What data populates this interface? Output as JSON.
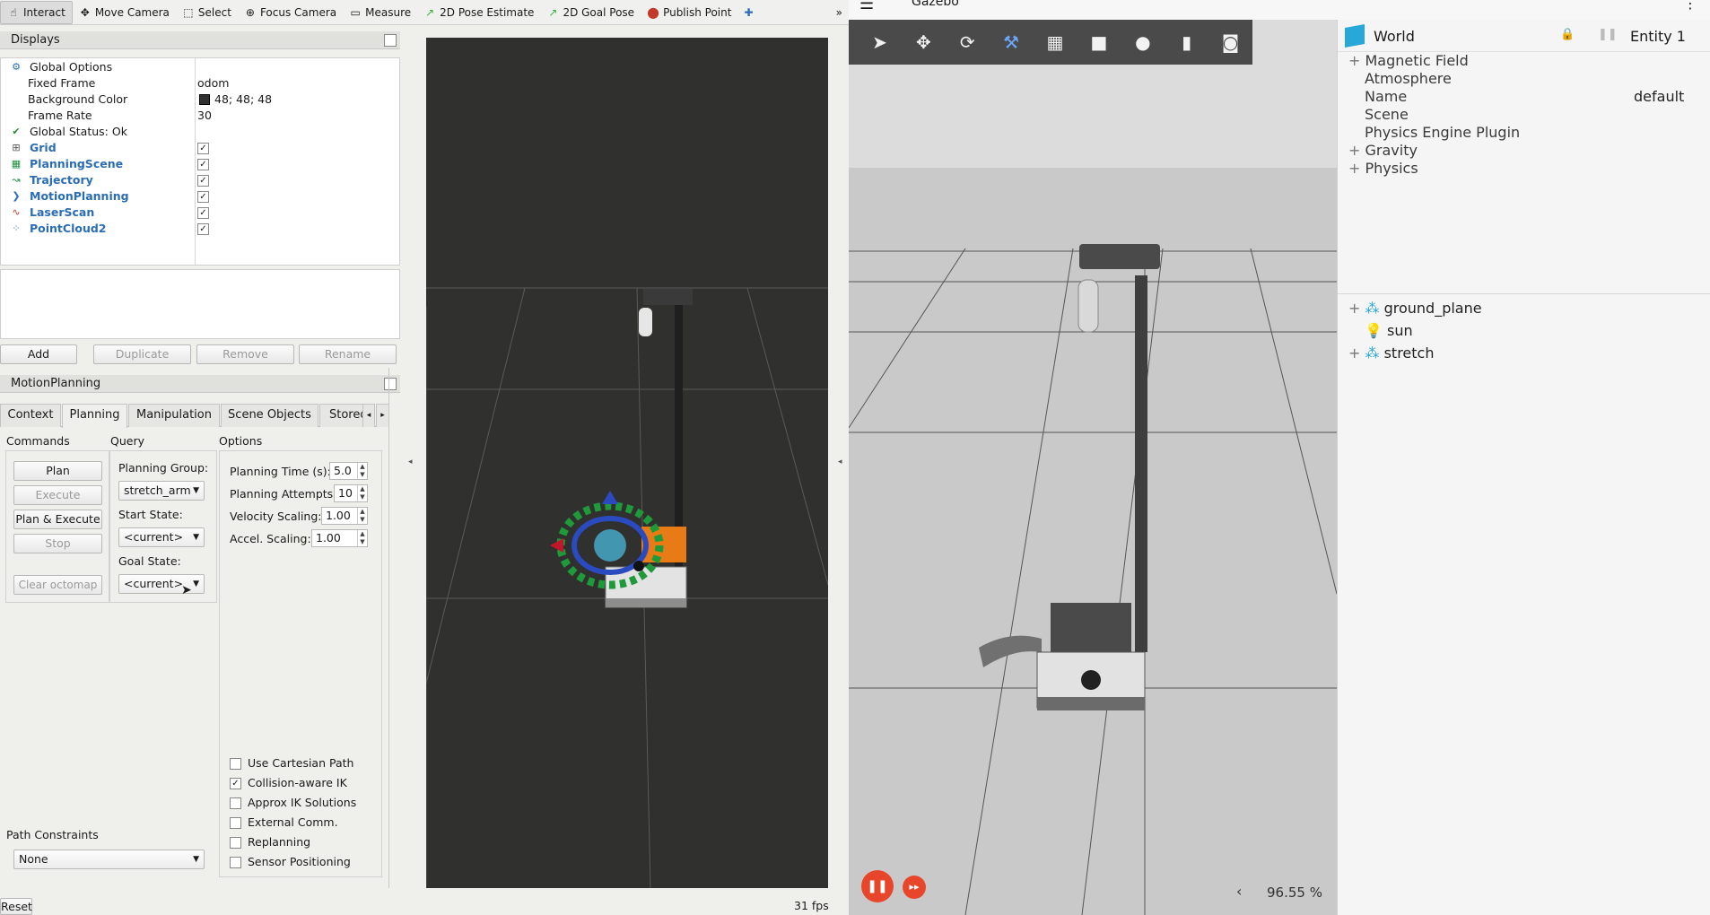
{
  "rviz": {
    "toolbar": [
      {
        "label": "Interact",
        "icon": "interact-icon",
        "glyph": "☝",
        "active": true
      },
      {
        "label": "Move Camera",
        "icon": "move-camera-icon",
        "glyph": "✥"
      },
      {
        "label": "Select",
        "icon": "select-icon",
        "glyph": "⬚"
      },
      {
        "label": "Focus Camera",
        "icon": "focus-camera-icon",
        "glyph": "⊕"
      },
      {
        "label": "Measure",
        "icon": "measure-icon",
        "glyph": "▭"
      },
      {
        "label": "2D Pose Estimate",
        "icon": "pose-estimate-icon",
        "glyph": "↗"
      },
      {
        "label": "2D Goal Pose",
        "icon": "goal-pose-icon",
        "glyph": "↗"
      },
      {
        "label": "Publish Point",
        "icon": "publish-point-icon",
        "glyph": "⬤"
      }
    ],
    "toolbar_more": "»",
    "toolbar_add": "✚",
    "displays": {
      "title": "Displays",
      "rows": [
        {
          "name": "Global Options",
          "value": ""
        },
        {
          "name": "Fixed Frame",
          "value": "odom"
        },
        {
          "name": "Background Color",
          "value": "48; 48; 48"
        },
        {
          "name": "Frame Rate",
          "value": "30"
        },
        {
          "name": "Global Status: Ok",
          "value": ""
        },
        {
          "name": "Grid",
          "value": "✓"
        },
        {
          "name": "PlanningScene",
          "value": "✓"
        },
        {
          "name": "Trajectory",
          "value": "✓"
        },
        {
          "name": "MotionPlanning",
          "value": "✓"
        },
        {
          "name": "LaserScan",
          "value": "✓"
        },
        {
          "name": "PointCloud2",
          "value": "✓"
        }
      ],
      "buttons": {
        "add": "Add",
        "duplicate": "Duplicate",
        "remove": "Remove",
        "rename": "Rename"
      }
    },
    "motion_planning": {
      "title": "MotionPlanning",
      "tabs": [
        "Context",
        "Planning",
        "Manipulation",
        "Scene Objects",
        "Stored"
      ],
      "selected_tab": "Planning",
      "commands": {
        "title": "Commands",
        "plan": "Plan",
        "execute": "Execute",
        "plan_execute": "Plan & Execute",
        "stop": "Stop",
        "clear_octomap": "Clear octomap"
      },
      "query": {
        "title": "Query",
        "planning_group_label": "Planning Group:",
        "planning_group": "stretch_arm",
        "start_state_label": "Start State:",
        "start_state": "<current>",
        "goal_state_label": "Goal State:",
        "goal_state": "<current>"
      },
      "options": {
        "title": "Options",
        "planning_time_label": "Planning Time (s):",
        "planning_time": "5.0",
        "planning_attempts_label": "Planning Attempts:",
        "planning_attempts": "10",
        "velocity_scaling_label": "Velocity Scaling:",
        "velocity_scaling": "1.00",
        "accel_scaling_label": "Accel. Scaling:",
        "accel_scaling": "1.00",
        "checkboxes": [
          {
            "label": "Use Cartesian Path",
            "checked": false
          },
          {
            "label": "Collision-aware IK",
            "checked": true
          },
          {
            "label": "Approx IK Solutions",
            "checked": false
          },
          {
            "label": "External Comm.",
            "checked": false
          },
          {
            "label": "Replanning",
            "checked": false
          },
          {
            "label": "Sensor Positioning",
            "checked": false
          }
        ]
      },
      "path_constraints_label": "Path Constraints",
      "path_constraints": "None"
    },
    "status": {
      "reset": "Reset",
      "fps": "31 fps"
    }
  },
  "gazebo": {
    "title": "Gazebo",
    "menu_glyph": "☰",
    "more_glyph": "⋮",
    "playback_zoom": "96.55 %",
    "playback_back": "‹",
    "play_pause_glyph": "❚❚",
    "step_glyph": "▸▸",
    "world_panel": {
      "title": "World",
      "entity": "Entity 1",
      "properties": [
        {
          "name": "Magnetic Field",
          "expandable": true
        },
        {
          "name": "Atmosphere",
          "expandable": false
        },
        {
          "name": "Name",
          "expandable": false,
          "value": "default"
        },
        {
          "name": "Scene",
          "expandable": false
        },
        {
          "name": "Physics Engine Plugin",
          "expandable": false
        },
        {
          "name": "Gravity",
          "expandable": true
        },
        {
          "name": "Physics",
          "expandable": true
        }
      ]
    },
    "entities": [
      {
        "name": "ground_plane",
        "expandable": true,
        "icon": "model-icon"
      },
      {
        "name": "sun",
        "expandable": false,
        "icon": "light-icon"
      },
      {
        "name": "stretch",
        "expandable": true,
        "icon": "model-icon"
      }
    ]
  },
  "colors": {
    "rviz_bg": "#303030",
    "link_blue": "#2a6db5",
    "gz_accent": "#e8462a",
    "gz_toolbar": "#4a4a4a"
  }
}
